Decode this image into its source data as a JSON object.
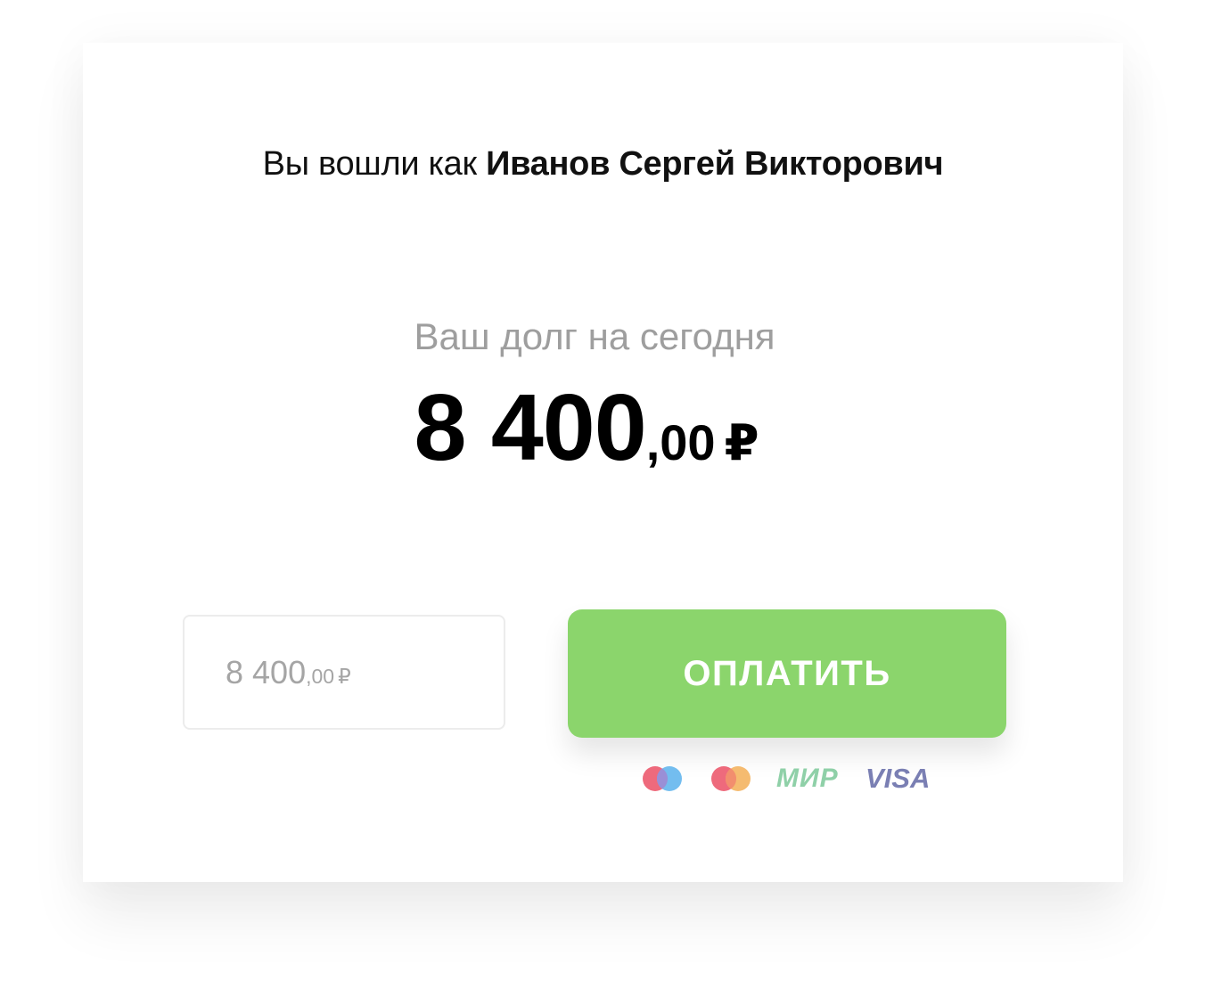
{
  "header": {
    "prefix": "Вы вошли как",
    "user_name": "Иванов Сергей Викторович"
  },
  "debt": {
    "caption": "Ваш долг на сегодня",
    "amount_int": "8 400",
    "amount_frac": ",00",
    "currency": "₽"
  },
  "payment_input": {
    "value_int": "8 400",
    "value_frac": ",00",
    "currency": "₽"
  },
  "pay_button": {
    "label": "ОПЛАТИТЬ",
    "color": "#8bd56c"
  },
  "payment_systems": {
    "maestro_icon": "maestro-icon",
    "mastercard_icon": "mastercard-icon",
    "mir_label": "МИР",
    "visa_label": "VISA"
  }
}
